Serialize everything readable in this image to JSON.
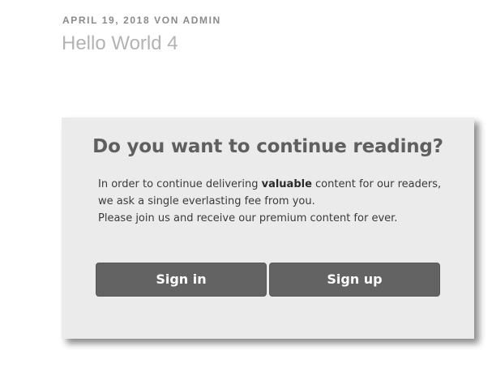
{
  "post": {
    "date": "April 19, 2018",
    "by": "von",
    "author": "admin",
    "title": "Hello World 4"
  },
  "paywall": {
    "heading": "Do you want to continue reading?",
    "line1_before": "In order to continue delivering ",
    "line1_bold": "valuable",
    "line1_after": " content for our readers,",
    "line2": "we ask a single everlasting fee from you.",
    "line3": "Please join us and receive our premium content for ever.",
    "signin_label": "Sign in",
    "signup_label": "Sign up"
  },
  "colors": {
    "box_background": "#ebebeb",
    "button_background": "#636363",
    "heading": "#5f5f5f",
    "title": "#b3b3b3",
    "meta": "#8a8a8a"
  }
}
